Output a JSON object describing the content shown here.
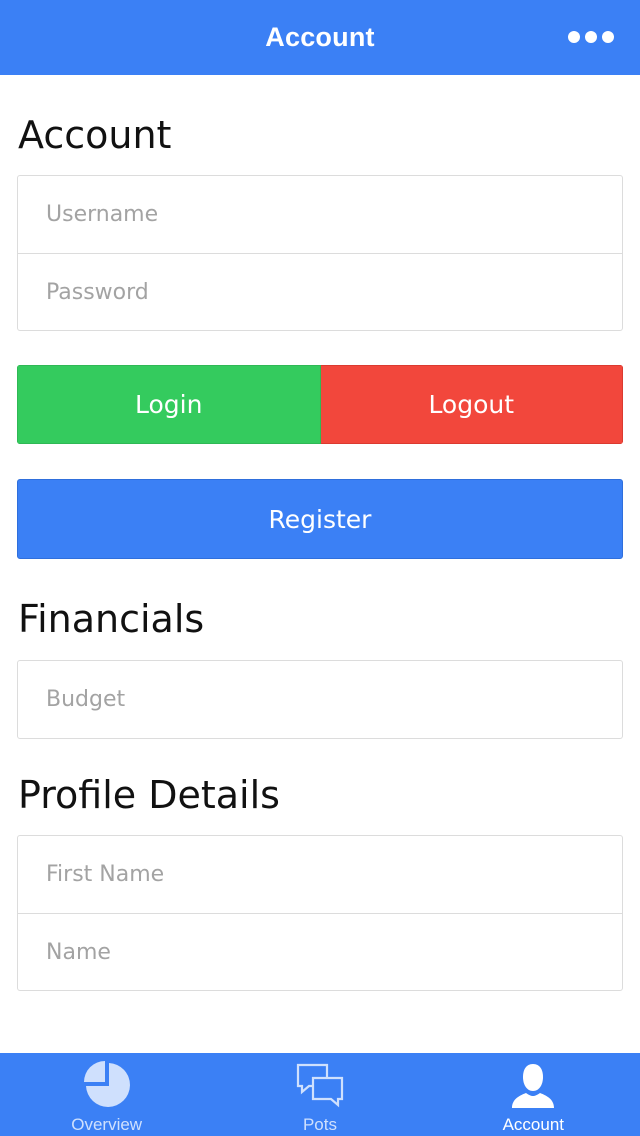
{
  "header": {
    "title": "Account",
    "more_icon": "more-horizontal-icon"
  },
  "sections": {
    "account": {
      "title": "Account",
      "username_placeholder": "Username",
      "password_placeholder": "Password",
      "login_label": "Login",
      "logout_label": "Logout",
      "register_label": "Register"
    },
    "financials": {
      "title": "Financials",
      "budget_placeholder": "Budget"
    },
    "profile": {
      "title": "Profile Details",
      "first_name_placeholder": "First Name",
      "name_placeholder": "Name"
    }
  },
  "tabbar": {
    "items": [
      {
        "label": "Overview",
        "icon": "pie-chart-icon",
        "active": false
      },
      {
        "label": "Pots",
        "icon": "chat-bubbles-icon",
        "active": false
      },
      {
        "label": "Account",
        "icon": "person-icon",
        "active": true
      }
    ]
  },
  "colors": {
    "primary": "#3b80f5",
    "success": "#34cb5e",
    "danger": "#f2473c"
  }
}
